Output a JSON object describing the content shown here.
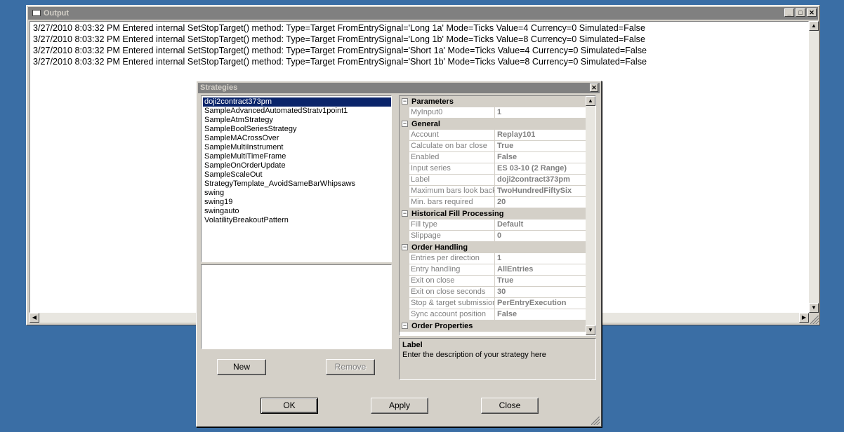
{
  "output": {
    "title": "Output",
    "lines": [
      "3/27/2010 8:03:32 PM Entered internal SetStopTarget() method: Type=Target FromEntrySignal='Long 1a' Mode=Ticks Value=4 Currency=0 Simulated=False",
      "3/27/2010 8:03:32 PM Entered internal SetStopTarget() method: Type=Target FromEntrySignal='Long 1b' Mode=Ticks Value=8 Currency=0 Simulated=False",
      "3/27/2010 8:03:32 PM Entered internal SetStopTarget() method: Type=Target FromEntrySignal='Short 1a' Mode=Ticks Value=4 Currency=0 Simulated=False",
      "3/27/2010 8:03:32 PM Entered internal SetStopTarget() method: Type=Target FromEntrySignal='Short 1b' Mode=Ticks Value=8 Currency=0 Simulated=False"
    ],
    "minimize_glyph": "_",
    "maximize_glyph": "□",
    "close_glyph": "✕"
  },
  "dialog": {
    "title": "Strategies",
    "close_glyph": "✕",
    "strategies": [
      "doji2contract373pm",
      "SampleAdvancedAutomatedStratv1point1",
      "SampleAtmStrategy",
      "SampleBoolSeriesStrategy",
      "SampleMACrossOver",
      "SampleMultiInstrument",
      "SampleMultiTimeFrame",
      "SampleOnOrderUpdate",
      "SampleScaleOut",
      "StrategyTemplate_AvoidSameBarWhipsaws",
      "swing",
      "swing19",
      "swingauto",
      "VolatilityBreakoutPattern"
    ],
    "selected_strategy": "doji2contract373pm",
    "new_label": "New",
    "remove_label": "Remove",
    "ok_label": "OK",
    "apply_label": "Apply",
    "close_label": "Close",
    "categories": [
      {
        "name": "Parameters",
        "props": [
          {
            "name": "MyInput0",
            "value": "1"
          }
        ]
      },
      {
        "name": "General",
        "props": [
          {
            "name": "Account",
            "value": "Replay101"
          },
          {
            "name": "Calculate on bar close",
            "value": "True"
          },
          {
            "name": "Enabled",
            "value": "False"
          },
          {
            "name": "Input series",
            "value": "ES 03-10 (2 Range)"
          },
          {
            "name": "Label",
            "value": "doji2contract373pm"
          },
          {
            "name": "Maximum bars look back",
            "value": "TwoHundredFiftySix"
          },
          {
            "name": "Min. bars required",
            "value": "20"
          }
        ]
      },
      {
        "name": "Historical Fill Processing",
        "props": [
          {
            "name": "Fill type",
            "value": "Default"
          },
          {
            "name": "Slippage",
            "value": "0"
          }
        ]
      },
      {
        "name": "Order Handling",
        "props": [
          {
            "name": "Entries per direction",
            "value": "1"
          },
          {
            "name": "Entry handling",
            "value": "AllEntries"
          },
          {
            "name": "Exit on close",
            "value": "True"
          },
          {
            "name": "Exit on close seconds",
            "value": "30"
          },
          {
            "name": "Stop & target submission",
            "value": "PerEntryExecution"
          },
          {
            "name": "Sync account position",
            "value": "False"
          }
        ]
      },
      {
        "name": "Order Properties",
        "props": []
      }
    ],
    "expand_glyph": "−",
    "help": {
      "title": "Label",
      "text": "Enter the description of your strategy here"
    }
  }
}
